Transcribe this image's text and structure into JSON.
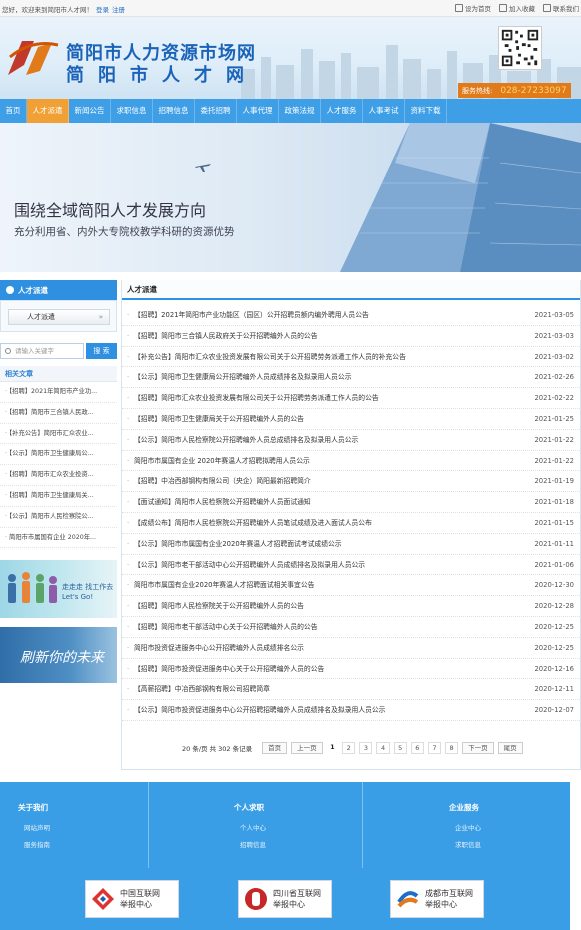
{
  "topbar": {
    "welcome": "您好，欢迎来到简阳市人才网！",
    "login": "登录",
    "register": "注册",
    "links": [
      "设为首页",
      "加入收藏",
      "联系我们"
    ]
  },
  "header": {
    "title_line1": "简阳市人力资源市场网",
    "title_line2": "简阳市人才网",
    "hotline_label": "服务热线:",
    "hotline_number": "028-27233097"
  },
  "nav": {
    "items": [
      "首页",
      "人才派遣",
      "新闻公告",
      "求职信息",
      "招聘信息",
      "委托招聘",
      "人事代理",
      "政策法规",
      "人才服务",
      "人事考试",
      "资料下载"
    ],
    "active_index": 1
  },
  "banner": {
    "line1": "围绕全域简阳人才发展方向",
    "line2": "充分利用省、内外大专院校教学科研的资源优势"
  },
  "sidebar": {
    "head": "人才派遣",
    "sub_item": "人才派遣",
    "search_placeholder": "请输入关键字",
    "search_button": "搜 索",
    "related_title": "相关文章",
    "related": [
      "【招聘】2021年简阳市产业功...",
      "【招聘】简阳市三合镇人民政...",
      "【补充公告】简阳市汇众农业...",
      "【公示】简阳市卫生健康局公...",
      "【招聘】简阳市汇众农业投资...",
      "【招聘】简阳市卫生健康局关...",
      "【公示】简阳市人民检察院公...",
      "简阳市市属国有企业 2020年..."
    ],
    "ad1_text_line1": "走走走 找工作去",
    "ad1_text_line2": "Let's Go!",
    "ad2_text": "刷新你的未来"
  },
  "main": {
    "title": "人才派遣",
    "rows": [
      {
        "title": "【招聘】2021年简阳市产业功能区（园区）公开招聘员额内编外聘用人员公告",
        "date": "2021-03-05"
      },
      {
        "title": "【招聘】简阳市三合镇人民政府关于公开招聘编外人员的公告",
        "date": "2021-03-03"
      },
      {
        "title": "【补充公告】简阳市汇众农业投资发展有限公司关于公开招聘劳务派遣工作人员的补充公告",
        "date": "2021-03-02"
      },
      {
        "title": "【公示】简阳市卫生健康局公开招聘编外人员成绩排名及拟录用人员公示",
        "date": "2021-02-26"
      },
      {
        "title": "【招聘】简阳市汇众农业投资发展有限公司关于公开招聘劳务派遣工作人员的公告",
        "date": "2021-02-22"
      },
      {
        "title": "【招聘】简阳市卫生健康局关于公开招聘编外人员的公告",
        "date": "2021-01-25"
      },
      {
        "title": "【公示】简阳市人民检察院公开招聘编外人员总成绩排名及拟录用人员公示",
        "date": "2021-01-22"
      },
      {
        "title": "简阳市市属国有企业 2020年赛温人才招聘拟聘用人员公示",
        "date": "2021-01-22"
      },
      {
        "title": "【招聘】中冶西部钢构有限公司（央企）简阳最新招聘简介",
        "date": "2021-01-19"
      },
      {
        "title": "【面试通知】简阳市人民检察院公开招聘编外人员面试通知",
        "date": "2021-01-18"
      },
      {
        "title": "【成绩公布】简阳市人民检察院公开招聘编外人员笔试成绩及进入面试人员公布",
        "date": "2021-01-15"
      },
      {
        "title": "【公示】简阳市市属国有企业2020年赛温人才招聘面试考试成绩公示",
        "date": "2021-01-11"
      },
      {
        "title": "【公示】简阳市老干部活动中心公开招聘编外人员成绩排名及拟录用人员公示",
        "date": "2021-01-06"
      },
      {
        "title": "简阳市市属国有企业2020年赛温人才招聘面试相关事宜公告",
        "date": "2020-12-30"
      },
      {
        "title": "【招聘】简阳市人民检察院关于公开招聘编外人员的公告",
        "date": "2020-12-28"
      },
      {
        "title": "【招聘】简阳市老干部活动中心关于公开招聘编外人员的公告",
        "date": "2020-12-25"
      },
      {
        "title": "简阳市投资促进服务中心公开招聘编外人员成绩排名公示",
        "date": "2020-12-25"
      },
      {
        "title": "【招聘】简阳市投资促进服务中心关于公开招聘编外人员的公告",
        "date": "2020-12-16"
      },
      {
        "title": "【高薪招聘】中冶西部钢构有限公司招聘简章",
        "date": "2020-12-11"
      },
      {
        "title": "【公示】简阳市投资促进服务中心公开招聘招聘编外人员成绩排名及拟录用人员公示",
        "date": "2020-12-07"
      }
    ],
    "pager": {
      "info": "20 条/页 共 302 条记录",
      "first": "首页",
      "prev": "上一页",
      "pages": [
        "1",
        "2",
        "3",
        "4",
        "5",
        "6",
        "7",
        "8"
      ],
      "current": "1",
      "next": "下一页",
      "last": "尾页"
    }
  },
  "footer": {
    "col1": {
      "title": "关于我们",
      "links": [
        "网站声明",
        "服务指南"
      ]
    },
    "col2": {
      "title": "个人求职",
      "links": [
        "个人中心",
        "招聘信息"
      ]
    },
    "col3": {
      "title": "企业服务",
      "links": [
        "企业中心",
        "求职信息"
      ]
    },
    "badges": [
      {
        "line1": "中国互联网",
        "line2": "举报中心"
      },
      {
        "line1": "四川省互联网",
        "line2": "举报中心"
      },
      {
        "line1": "成都市互联网",
        "line2": "举报中心"
      }
    ]
  }
}
